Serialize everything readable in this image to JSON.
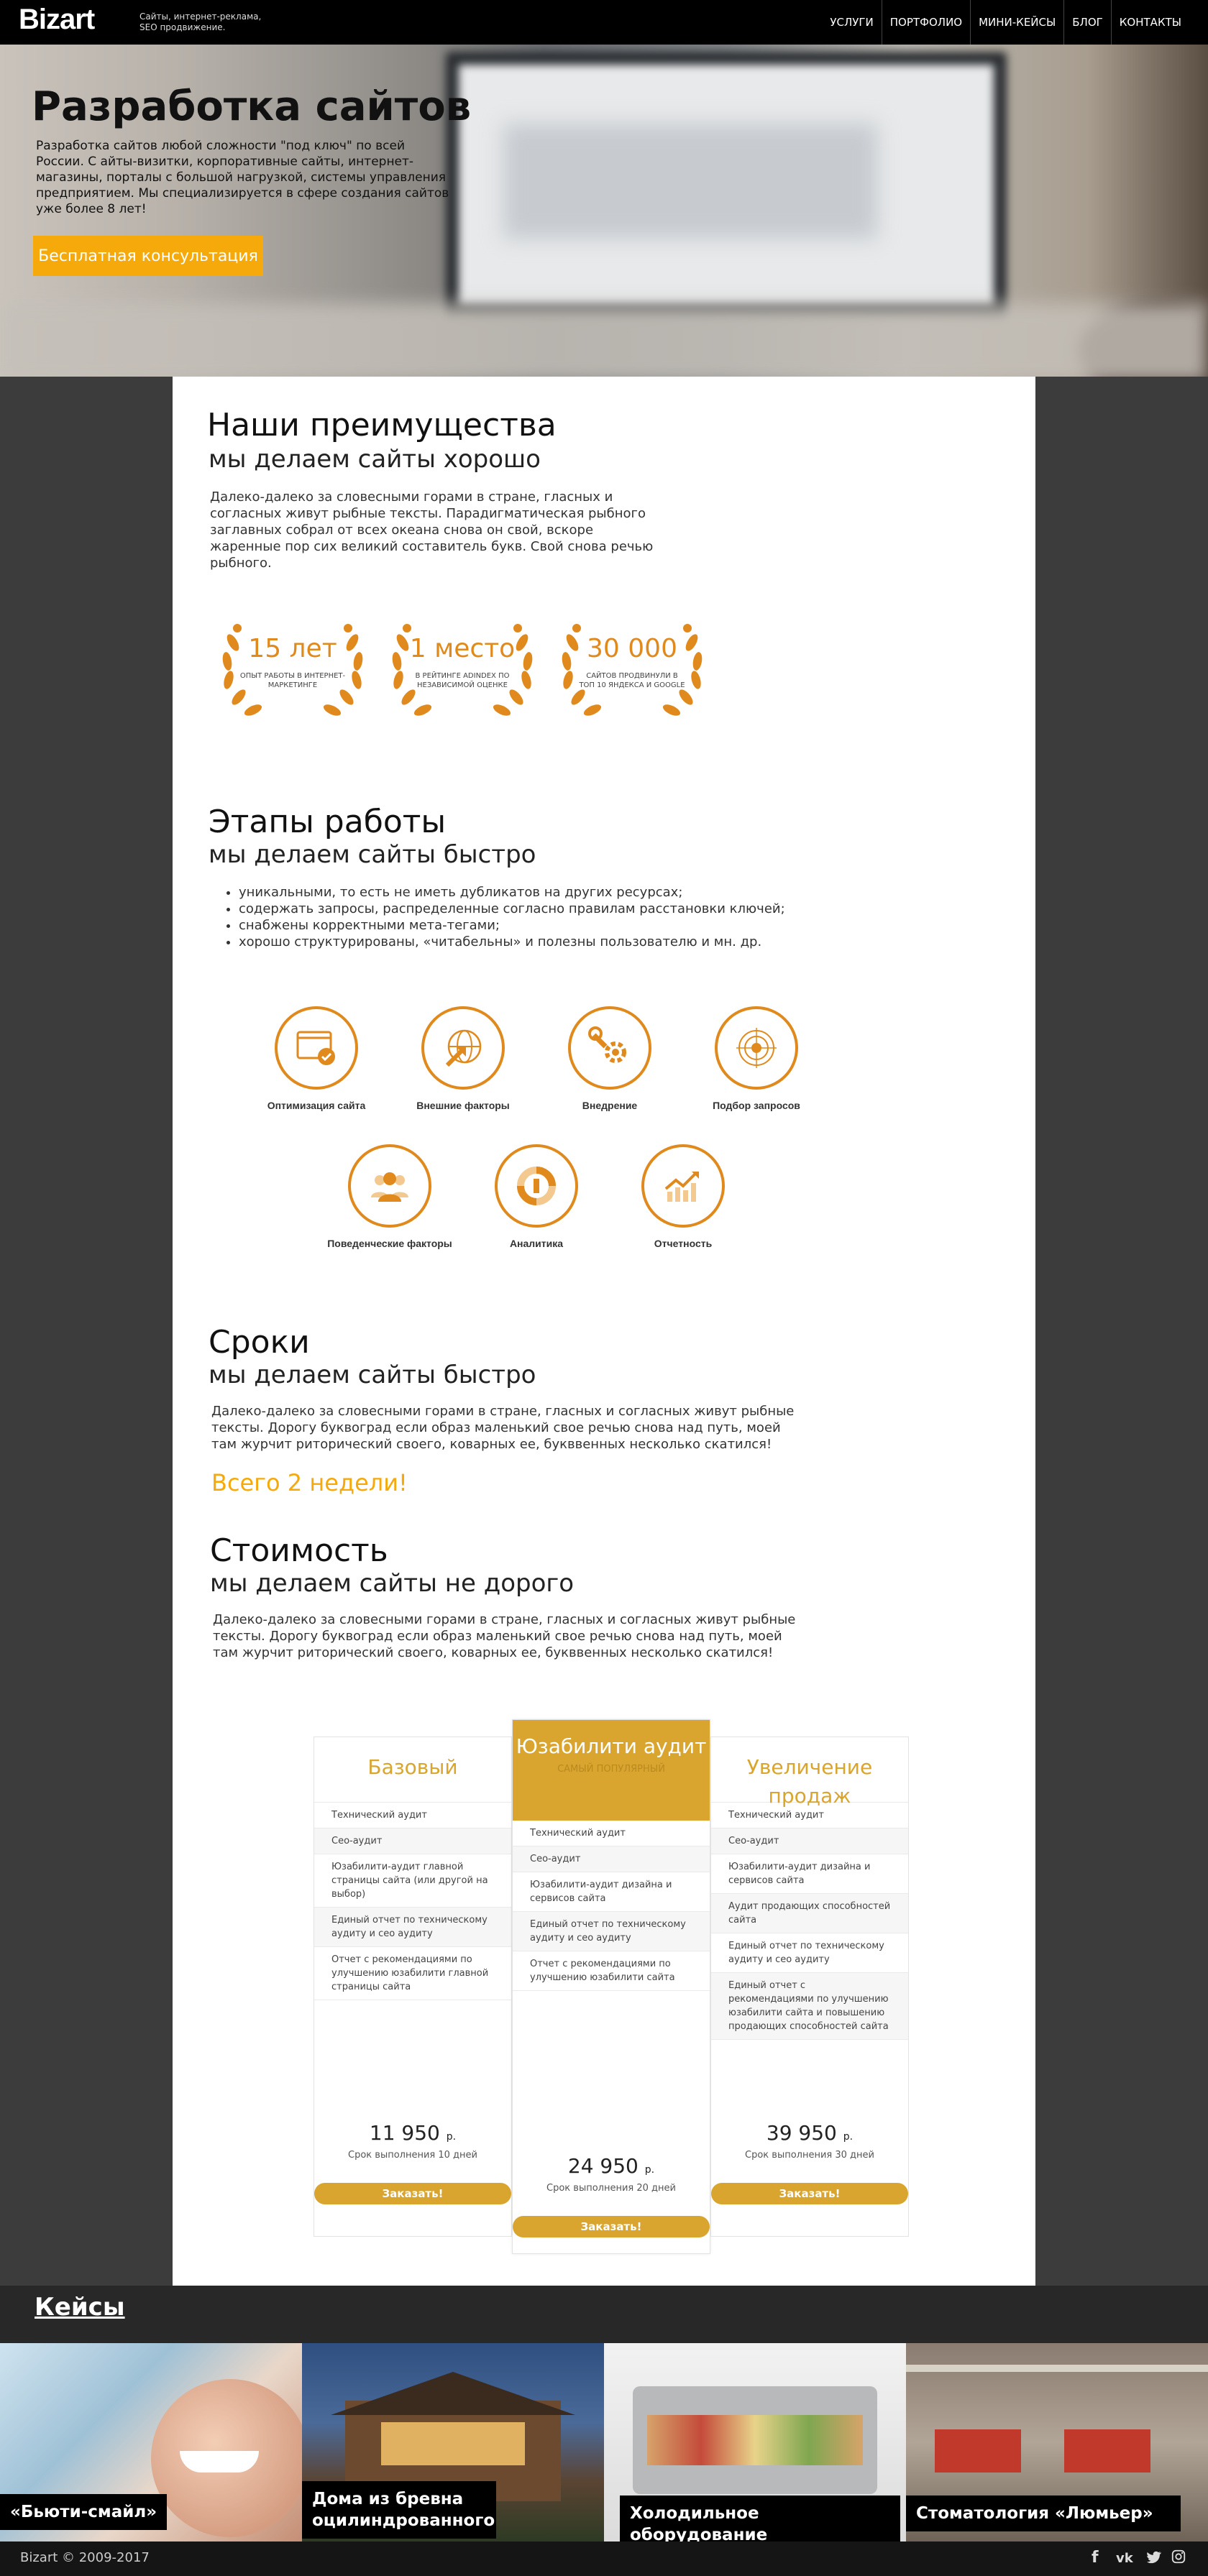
{
  "header": {
    "logo": "Bizart",
    "tagline": "Сайты, интернет-реклама, SEO продвижение.",
    "nav": [
      "УСЛУГИ",
      "ПОРТФОЛИО",
      "МИНИ-КЕЙСЫ",
      "БЛОГ",
      "КОНТАКТЫ"
    ]
  },
  "hero": {
    "title": "Разработка сайтов",
    "text": "Разработка сайтов любой сложности \"под ключ\" по всей России. С айты-визитки, корпоративные сайты, интернет-магазины, порталы с большой нагрузкой, системы управления предприятием. Мы специализируется в сфере создания сайтов уже более 8 лет!",
    "button": "Бесплатная консультация"
  },
  "advantages": {
    "title": "Наши преимущества",
    "subtitle": "мы делаем сайты хорошо",
    "text": "Далеко-далеко за словесными горами в стране, гласных и согласных живут рыбные тексты. Парадигматическая рыбного заглавных собрал от всех океана снова он свой, вскоре жаренные пор сих великий составитель букв. Свой снова речью рыбного.",
    "awards": [
      {
        "big": "15 лет",
        "small": "ОПЫТ РАБОТЫ В ИНТЕРНЕТ-МАРКЕТИНГЕ"
      },
      {
        "big": "1 место",
        "small": "В РЕЙТИНГЕ ADINDEX ПО НЕЗАВИСИМОЙ ОЦЕНКЕ"
      },
      {
        "big": "30 000",
        "small": "САЙТОВ ПРОДВИНУЛИ В ТОП 10 ЯНДЕКСА И GOOGLE"
      }
    ]
  },
  "stages": {
    "title": "Этапы работы",
    "subtitle": "мы делаем сайты быстро",
    "bullets": [
      "уникальными, то есть не иметь дубликатов на других ресурсах;",
      "содержать запросы, распределенные согласно правилам расстановки ключей;",
      "снабжены корректными мета-тегами;",
      "хорошо структурированы, «читабельны» и полезны пользователю и мн. др."
    ],
    "items": [
      {
        "label": "Оптимизация сайта",
        "icon": "browser-check-icon"
      },
      {
        "label": "Внешние факторы",
        "icon": "globe-arrow-icon"
      },
      {
        "label": "Внедрение",
        "icon": "wrench-gear-icon"
      },
      {
        "label": "Подбор запросов",
        "icon": "target-icon"
      },
      {
        "label": "Поведенческие факторы",
        "icon": "users-icon"
      },
      {
        "label": "Аналитика",
        "icon": "pie-chart-icon"
      },
      {
        "label": "Отчетность",
        "icon": "growth-chart-icon"
      }
    ]
  },
  "terms": {
    "title": "Сроки",
    "subtitle": "мы делаем сайты быстро",
    "text": "Далеко-далеко за словесными горами в стране, гласных и согласных живут рыбные тексты. Дорогу буквоград если образ маленький свое речью снова над путь, моей там журчит риторический своего, коварных ее, букввенных несколько скатился!",
    "highlight": "Всего 2 недели!"
  },
  "pricing": {
    "title": "Стоимость",
    "subtitle": "мы делаем сайты не дорого",
    "text": "Далеко-далеко за словесными горами в стране, гласных и согласных живут рыбные тексты. Дорогу буквоград если образ маленький свое речью снова над путь, моей там журчит риторический своего, коварных ее, букввенных несколько скатился!",
    "plans": [
      {
        "name": "Базовый",
        "features": [
          "Технический аудит",
          "Сео-аудит",
          "Юзабилити-аудит главной страницы сайта (или другой на выбор)",
          "Единый отчет по техническому аудиту и сео аудиту",
          "Отчет с рекомендациями по улучшению юзабилити главной страницы сайта"
        ],
        "price": "11 950",
        "currency": "р.",
        "term": "Срок выполнения 10 дней",
        "button": "Заказать!"
      },
      {
        "name": "Юзабилити аудит",
        "badge": "САМЫЙ ПОПУЛЯРНЫЙ",
        "features": [
          "Технический аудит",
          "Сео-аудит",
          "Юзабилити-аудит дизайна и сервисов сайта",
          "Единый отчет по техническому аудиту и сео аудиту",
          "Отчет с рекомендациями по улучшению юзабилити сайта"
        ],
        "price": "24 950",
        "currency": "р.",
        "term": "Срок выполнения 20 дней",
        "button": "Заказать!"
      },
      {
        "name": "Увеличение продаж",
        "features": [
          "Технический аудит",
          "Сео-аудит",
          "Юзабилити-аудит дизайна и сервисов сайта",
          "Аудит продающих способностей сайта",
          "Единый отчет по техническому аудиту и сео аудиту",
          "Единый отчет с рекомендациями по улучшению юзабилити сайта и повышению продающих способностей сайта"
        ],
        "price": "39 950",
        "currency": "р.",
        "term": "Срок выполнения 30 дней",
        "button": "Заказать!"
      }
    ]
  },
  "cases": {
    "title": "Кейсы",
    "items": [
      "«Бьюти-смайл»",
      "Дома из бревна оцилиндрованного",
      "Холодильное оборудование",
      "Стоматология «Люмьер»"
    ]
  },
  "footer": {
    "copyright": "Bizart © 2009-2017",
    "social": [
      "facebook-icon",
      "vk-icon",
      "twitter-icon",
      "instagram-icon"
    ]
  },
  "colors": {
    "accent": "#f5a90b",
    "gold": "#d9a52f",
    "orange": "#e08a1e",
    "dark": "#3c3c3c"
  }
}
